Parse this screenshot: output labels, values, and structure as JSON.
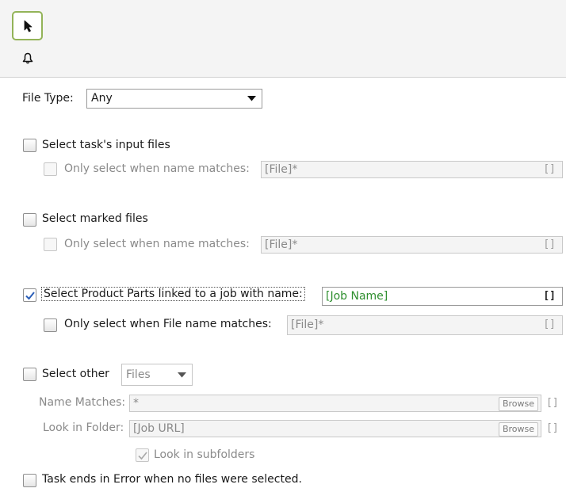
{
  "toolbar": {
    "pointer_tool": "pointer-arrow-icon",
    "bell_tool": "bell-icon"
  },
  "file_type": {
    "label": "File Type:",
    "value": "Any"
  },
  "sections": {
    "input_files": {
      "label": "Select task's input files",
      "checked": false,
      "sub_label": "Only select when name matches:",
      "sub_value": "[File]*",
      "brackets": "[]"
    },
    "marked_files": {
      "label": "Select marked files",
      "checked": false,
      "sub_label": "Only select when name matches:",
      "sub_value": "[File]*",
      "brackets": "[]"
    },
    "product_parts": {
      "label": "Select Product Parts linked to a job with name:",
      "checked": true,
      "value": "[Job Name]",
      "brackets": "[]",
      "sub_label": "Only select when File name matches:",
      "sub_value": "[File]*",
      "sub_brackets": "[]"
    },
    "other": {
      "label": "Select other",
      "select_value": "Files",
      "name_matches_label": "Name Matches:",
      "name_matches_value": "*",
      "look_in_folder_label": "Look in Folder:",
      "look_in_folder_value": "[Job URL]",
      "browse_label": "Browse",
      "brackets": "[]",
      "subfolders_label": "Look in subfolders",
      "subfolders_checked": true
    },
    "error": {
      "label": "Task ends in Error when no files were selected.",
      "checked": false
    }
  },
  "colors": {
    "accent_border": "#93b358",
    "active_value": "#2f8f2f",
    "check": "#2b5fb8"
  }
}
